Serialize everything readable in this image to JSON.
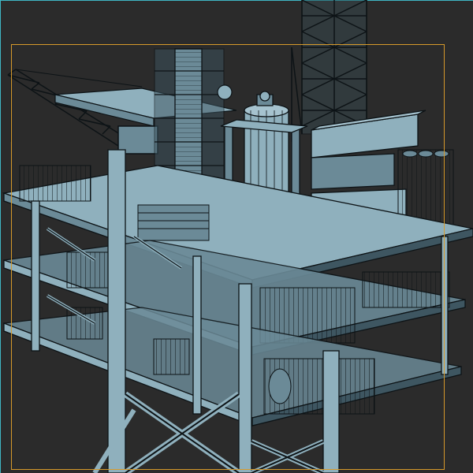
{
  "viewport": {
    "view_label": "",
    "colors": {
      "background": "#2b2b2b",
      "viewport_border": "#3fb6c4",
      "safe_frame": "#d79a2b",
      "model_fill": "#6b8a97",
      "model_light": "#8fb0bd",
      "model_dark": "#3e5661",
      "wire": "#0d1316"
    }
  },
  "scene": {
    "subject": "offshore-platform-wireframe-model"
  }
}
